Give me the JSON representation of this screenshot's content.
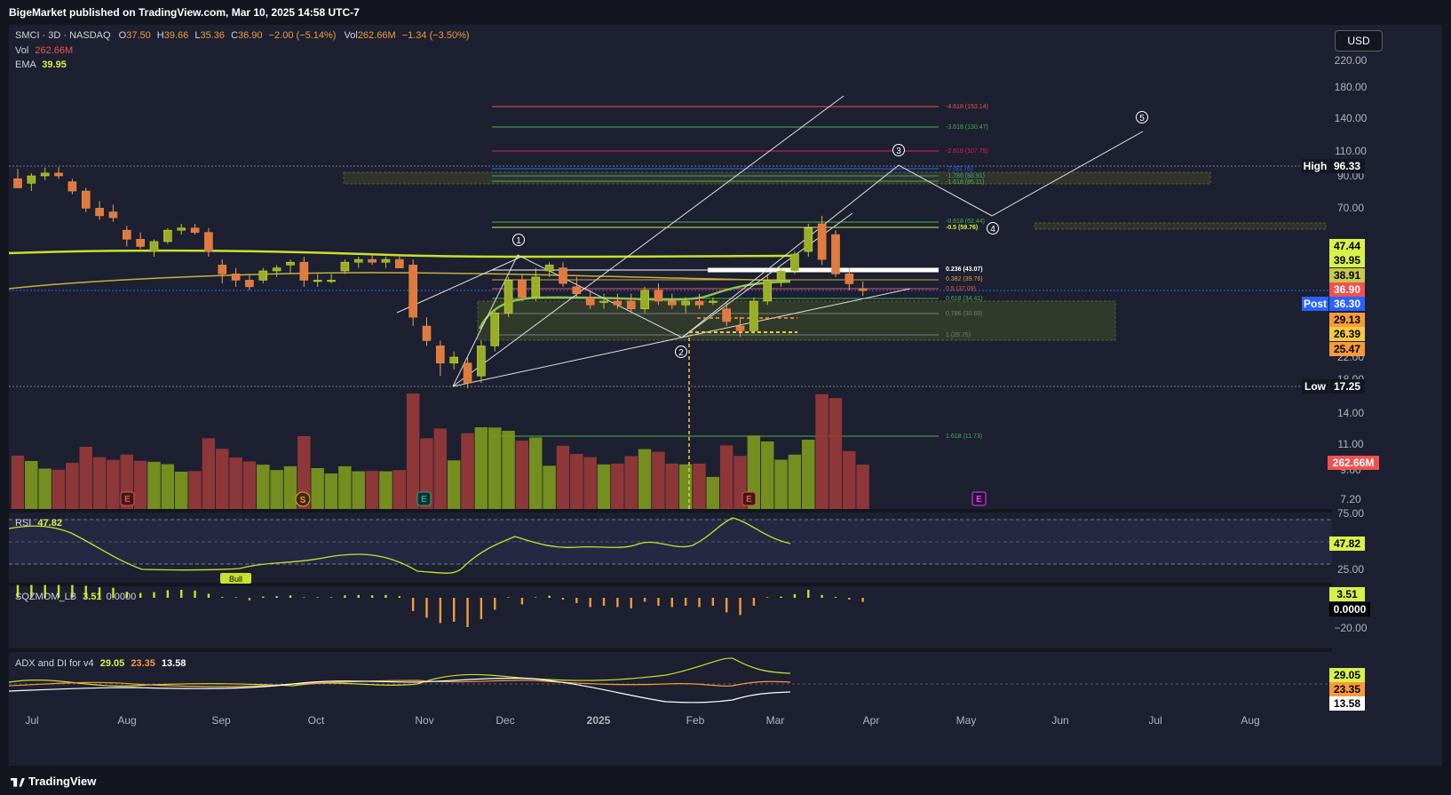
{
  "header": {
    "published": "BigeMarket published on TradingView.com, Mar 10, 2025 14:58 UTC-7"
  },
  "footer": {
    "brand": "TradingView"
  },
  "currency_button": "USD",
  "legend": {
    "symbol": "SMCI · 3D · NASDAQ",
    "o_label": "O",
    "o": "37.50",
    "h_label": "H",
    "h": "39.66",
    "l_label": "L",
    "l": "35.36",
    "c_label": "C",
    "c": "36.90",
    "change": "−2.00 (−5.14%)",
    "vol_label": "Vol",
    "vol": "262.66M",
    "vol_change": "−1.34 (−3.50%)",
    "vol2_label": "Vol",
    "vol2": "262.66M",
    "ema_label": "EMA",
    "ema": "39.95"
  },
  "price_axis": [
    "220.00",
    "180.00",
    "140.00",
    "110.00",
    "90.00",
    "70.00",
    "22.00",
    "18.00",
    "14.00",
    "11.00",
    "9.00",
    "7.20"
  ],
  "price_tags": [
    {
      "label": "High",
      "value": "96.33",
      "bg": "#131722",
      "fg": "#ffffff"
    },
    {
      "value": "47.44",
      "bg": "#d9f04a",
      "fg": "#000000"
    },
    {
      "value": "39.95",
      "bg": "#d9f04a",
      "fg": "#000000"
    },
    {
      "value": "38.91",
      "bg": "#c8c84a",
      "fg": "#000000"
    },
    {
      "value": "36.90",
      "bg": "#ef5350",
      "fg": "#ffffff"
    },
    {
      "label": "Post",
      "value": "36.30",
      "bg": "#2962ff",
      "fg": "#ffffff"
    },
    {
      "value": "29.13",
      "bg": "#f59b3a",
      "fg": "#000000"
    },
    {
      "value": "26.39",
      "bg": "#f5c842",
      "fg": "#000000"
    },
    {
      "value": "25.47",
      "bg": "#f59b3a",
      "fg": "#000000"
    },
    {
      "label": "Low",
      "value": "17.25",
      "bg": "#131722",
      "fg": "#ffffff"
    },
    {
      "value": "262.66M",
      "bg": "#ef5350",
      "fg": "#ffffff"
    }
  ],
  "fib_labels": [
    {
      "text": "-4.618 (153.14)",
      "color": "#ef5350"
    },
    {
      "text": "-3.618 (130.47)",
      "color": "#4caf50"
    },
    {
      "text": "-2.618 (107.79)",
      "color": "#e91e63"
    },
    {
      "text": "-2 (93.76)",
      "color": "#2962ff"
    },
    {
      "text": "-1.786 (88.91)",
      "color": "#26a69a"
    },
    {
      "text": "-1.618 (85.11)",
      "color": "#4caf50"
    },
    {
      "text": "-0.618 (62.44)",
      "color": "#4caf50"
    },
    {
      "text": "-0.5 (59.76)",
      "color": "#d9f04a"
    },
    {
      "text": "0.236 (43.07)",
      "color": "#ffffff"
    },
    {
      "text": "0.382 (39.76)",
      "color": "#d9a441"
    },
    {
      "text": "0.5 (37.09)",
      "color": "#ef5350"
    },
    {
      "text": "0.618 (34.41)",
      "color": "#4caf50"
    },
    {
      "text": "0.786 (30.60)",
      "color": "#787b86"
    },
    {
      "text": "1 (25.75)",
      "color": "#787b86"
    },
    {
      "text": "1.618 (11.73)",
      "color": "#4caf50"
    }
  ],
  "wave_labels": [
    "1",
    "2",
    "3",
    "4",
    "5"
  ],
  "earnings_markers": [
    {
      "label": "E",
      "color": "#ef5350"
    },
    {
      "label": "S",
      "color": "#f59b3a"
    },
    {
      "label": "E",
      "color": "#26a69a"
    },
    {
      "label": "E",
      "color": "#ef5350"
    },
    {
      "label": "E",
      "color": "#e040fb"
    }
  ],
  "rsi": {
    "label": "RSI",
    "value": "47.82",
    "axis": [
      "75.00",
      "25.00"
    ],
    "bull_tag": "Bull"
  },
  "sqz": {
    "label": "SQZMOM_LB",
    "value": "3.51",
    "value2": "0.0000",
    "axis": [
      "−20.00"
    ]
  },
  "adx": {
    "label": "ADX and DI for v4",
    "v1": "29.05",
    "v2": "23.35",
    "v3": "13.58"
  },
  "time_axis": [
    "Jul",
    "Aug",
    "Sep",
    "Oct",
    "Nov",
    "Dec",
    "2025",
    "Feb",
    "Mar",
    "Apr",
    "May",
    "Jun",
    "Jul",
    "Aug"
  ],
  "chart_data": {
    "type": "candlestick",
    "symbol": "SMCI",
    "interval": "3D",
    "scale": "log",
    "candles": [
      {
        "o": 88,
        "h": 95,
        "l": 82,
        "c": 82
      },
      {
        "o": 85,
        "h": 92,
        "l": 80,
        "c": 90
      },
      {
        "o": 90,
        "h": 96,
        "l": 87,
        "c": 92
      },
      {
        "o": 92,
        "h": 96.33,
        "l": 88,
        "c": 90
      },
      {
        "o": 86,
        "h": 88,
        "l": 78,
        "c": 80
      },
      {
        "o": 80,
        "h": 82,
        "l": 68,
        "c": 70
      },
      {
        "o": 70,
        "h": 74,
        "l": 64,
        "c": 66
      },
      {
        "o": 68,
        "h": 72,
        "l": 63,
        "c": 65
      },
      {
        "o": 59,
        "h": 61,
        "l": 52,
        "c": 55
      },
      {
        "o": 55,
        "h": 58,
        "l": 51,
        "c": 52
      },
      {
        "o": 50,
        "h": 55,
        "l": 48,
        "c": 54
      },
      {
        "o": 54,
        "h": 60,
        "l": 53,
        "c": 59
      },
      {
        "o": 59,
        "h": 62,
        "l": 57,
        "c": 60
      },
      {
        "o": 60,
        "h": 62,
        "l": 57,
        "c": 58
      },
      {
        "o": 58,
        "h": 60,
        "l": 48,
        "c": 50
      },
      {
        "o": 45,
        "h": 47,
        "l": 39,
        "c": 42
      },
      {
        "o": 42,
        "h": 44,
        "l": 38,
        "c": 40
      },
      {
        "o": 40,
        "h": 42,
        "l": 37,
        "c": 38
      },
      {
        "o": 40,
        "h": 44,
        "l": 39,
        "c": 43
      },
      {
        "o": 43,
        "h": 45,
        "l": 41,
        "c": 44
      },
      {
        "o": 45,
        "h": 47,
        "l": 42,
        "c": 46
      },
      {
        "o": 46,
        "h": 48,
        "l": 38,
        "c": 40
      },
      {
        "o": 40,
        "h": 42,
        "l": 38,
        "c": 40
      },
      {
        "o": 40,
        "h": 42,
        "l": 39,
        "c": 40
      },
      {
        "o": 43,
        "h": 47,
        "l": 42,
        "c": 46
      },
      {
        "o": 46,
        "h": 48,
        "l": 44,
        "c": 47
      },
      {
        "o": 47,
        "h": 49,
        "l": 45,
        "c": 46
      },
      {
        "o": 46,
        "h": 48,
        "l": 44,
        "c": 47
      },
      {
        "o": 47,
        "h": 48,
        "l": 44,
        "c": 44
      },
      {
        "o": 45,
        "h": 47,
        "l": 28,
        "c": 30
      },
      {
        "o": 28,
        "h": 30,
        "l": 24,
        "c": 25
      },
      {
        "o": 24,
        "h": 25,
        "l": 19,
        "c": 21
      },
      {
        "o": 21,
        "h": 23,
        "l": 20,
        "c": 22
      },
      {
        "o": 21,
        "h": 22,
        "l": 17.25,
        "c": 18
      },
      {
        "o": 19,
        "h": 25,
        "l": 18,
        "c": 24
      },
      {
        "o": 24,
        "h": 32,
        "l": 23,
        "c": 31
      },
      {
        "o": 31,
        "h": 41,
        "l": 30,
        "c": 40
      },
      {
        "o": 40,
        "h": 42,
        "l": 34,
        "c": 35
      },
      {
        "o": 35,
        "h": 44,
        "l": 34,
        "c": 41
      },
      {
        "o": 43,
        "h": 46,
        "l": 41,
        "c": 45
      },
      {
        "o": 44,
        "h": 46,
        "l": 38,
        "c": 39
      },
      {
        "o": 38,
        "h": 41,
        "l": 35,
        "c": 36
      },
      {
        "o": 35,
        "h": 37,
        "l": 32,
        "c": 33
      },
      {
        "o": 34,
        "h": 36,
        "l": 32,
        "c": 34
      },
      {
        "o": 34,
        "h": 36,
        "l": 32,
        "c": 33
      },
      {
        "o": 34,
        "h": 36,
        "l": 31,
        "c": 32
      },
      {
        "o": 32,
        "h": 38,
        "l": 31,
        "c": 37
      },
      {
        "o": 37,
        "h": 39,
        "l": 33,
        "c": 34
      },
      {
        "o": 34,
        "h": 36,
        "l": 32,
        "c": 33
      },
      {
        "o": 33,
        "h": 35,
        "l": 31,
        "c": 34
      },
      {
        "o": 34,
        "h": 36,
        "l": 32,
        "c": 33
      },
      {
        "o": 34,
        "h": 35,
        "l": 33,
        "c": 34
      },
      {
        "o": 32,
        "h": 34,
        "l": 28,
        "c": 29
      },
      {
        "o": 28,
        "h": 30,
        "l": 25.75,
        "c": 27
      },
      {
        "o": 27,
        "h": 35,
        "l": 26.4,
        "c": 34
      },
      {
        "o": 34,
        "h": 42,
        "l": 33,
        "c": 40
      },
      {
        "o": 40,
        "h": 44,
        "l": 38,
        "c": 43
      },
      {
        "o": 43,
        "h": 50,
        "l": 42,
        "c": 49
      },
      {
        "o": 50,
        "h": 62,
        "l": 48,
        "c": 60
      },
      {
        "o": 62,
        "h": 66,
        "l": 45,
        "c": 47
      },
      {
        "o": 57,
        "h": 59,
        "l": 41,
        "c": 42
      },
      {
        "o": 42,
        "h": 44,
        "l": 37,
        "c": 38.9
      },
      {
        "o": 37.5,
        "h": 39.66,
        "l": 35.36,
        "c": 36.9
      }
    ],
    "volume_bars": 63,
    "ema_value": 39.95,
    "levels": {
      "high": 96.33,
      "low": 17.25,
      "last": 36.9,
      "post": 36.3
    },
    "indicators": {
      "rsi": 47.82,
      "sqzmom": 3.51,
      "adx": [
        29.05,
        23.35,
        13.58
      ]
    }
  }
}
